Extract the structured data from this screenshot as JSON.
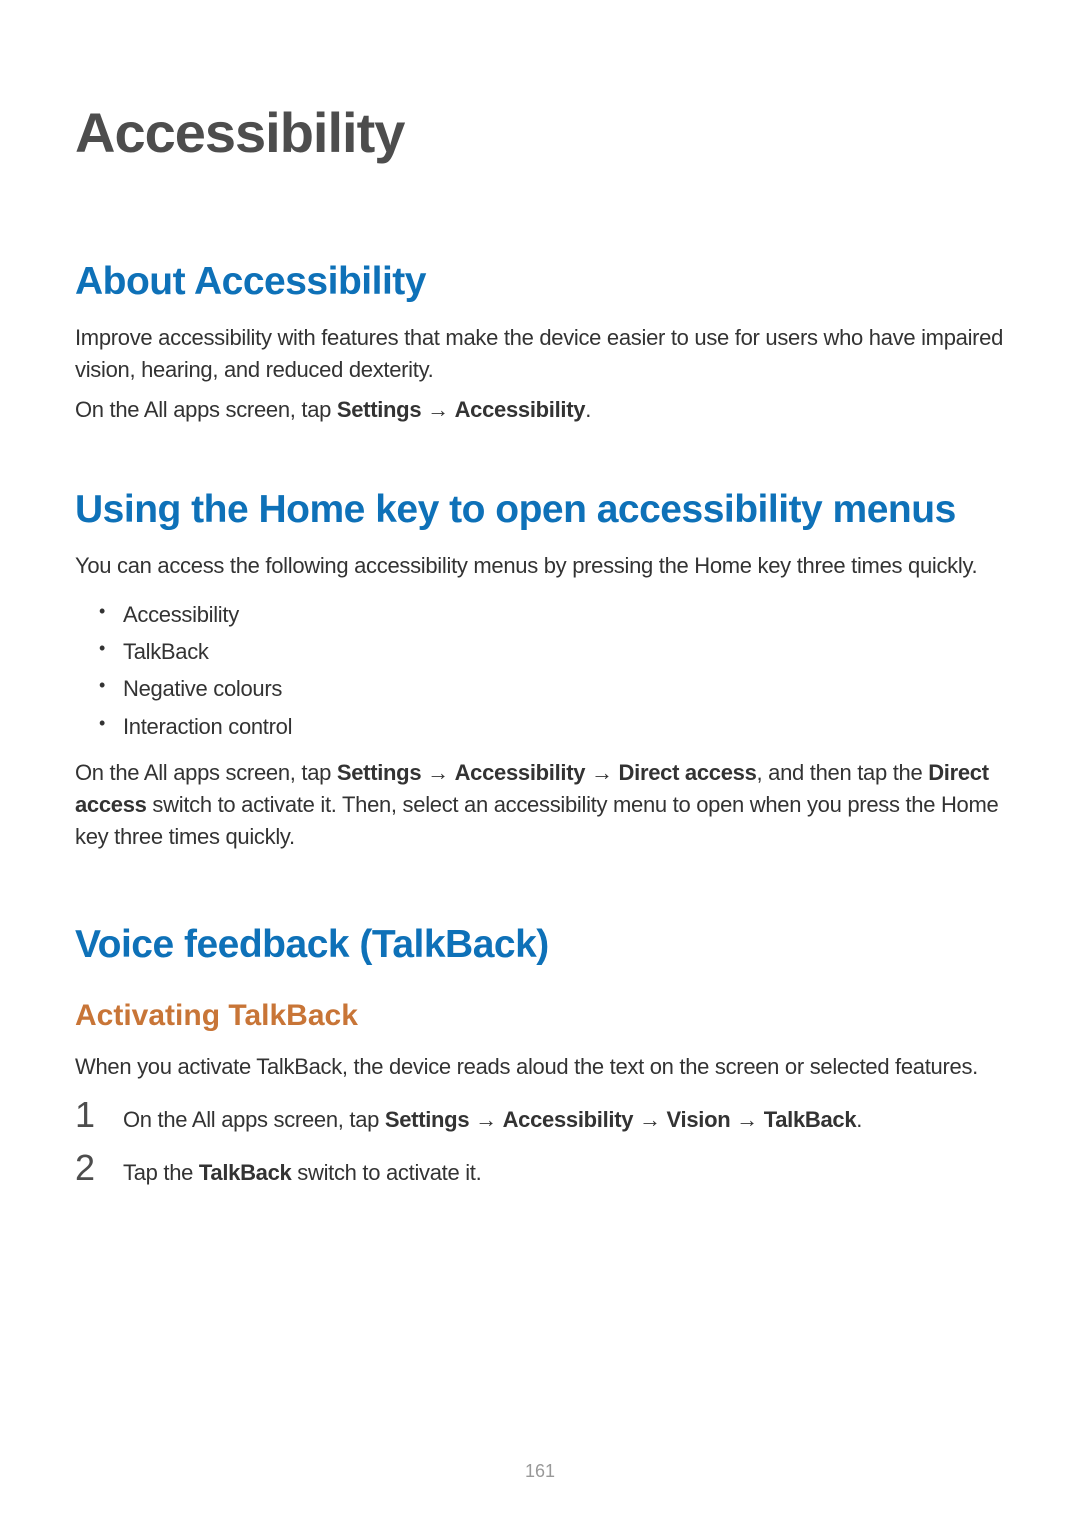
{
  "title": "Accessibility",
  "section_about": {
    "heading": "About Accessibility",
    "p1": "Improve accessibility with features that make the device easier to use for users who have impaired vision, hearing, and reduced dexterity.",
    "p2_prefix": "On the All apps screen, tap ",
    "p2_b1": "Settings",
    "arrow": " → ",
    "p2_b2": "Accessibility",
    "p2_suffix": "."
  },
  "section_home": {
    "heading": "Using the Home key to open accessibility menus",
    "p1": "You can access the following accessibility menus by pressing the Home key three times quickly.",
    "bullets": {
      "b1": "Accessibility",
      "b2": "TalkBack",
      "b3": "Negative colours",
      "b4": "Interaction control"
    },
    "p2_prefix": "On the All apps screen, tap ",
    "p2_b1": "Settings",
    "p2_b2": "Accessibility",
    "p2_b3": "Direct access",
    "p2_mid": ", and then tap the ",
    "p2_b4": "Direct access",
    "p2_suffix": " switch to activate it. Then, select an accessibility menu to open when you press the Home key three times quickly."
  },
  "section_talkback": {
    "heading": "Voice feedback (TalkBack)",
    "sub_heading": "Activating TalkBack",
    "p1": "When you activate TalkBack, the device reads aloud the text on the screen or selected features.",
    "step1_num": "1",
    "step1_prefix": "On the All apps screen, tap ",
    "step1_b1": "Settings",
    "step1_b2": "Accessibility",
    "step1_b3": "Vision",
    "step1_b4": "TalkBack",
    "step1_suffix": ".",
    "step2_num": "2",
    "step2_prefix": "Tap the ",
    "step2_b1": "TalkBack",
    "step2_suffix": " switch to activate it."
  },
  "page_number": "161"
}
